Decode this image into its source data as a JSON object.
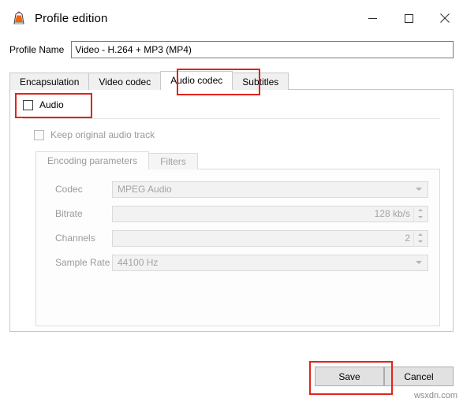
{
  "window": {
    "title": "Profile edition",
    "icon": "vlc-cone-icon",
    "controls": {
      "minimize": "minimize-icon",
      "maximize": "maximize-icon",
      "close": "close-icon"
    }
  },
  "profile": {
    "label": "Profile Name",
    "value": "Video - H.264 + MP3 (MP4)",
    "placeholder": ""
  },
  "tabs": [
    {
      "label": "Encapsulation",
      "active": false
    },
    {
      "label": "Video codec",
      "active": false
    },
    {
      "label": "Audio codec",
      "active": true
    },
    {
      "label": "Subtitles",
      "active": false
    }
  ],
  "audio_panel": {
    "audio_checkbox": {
      "label": "Audio",
      "checked": false
    },
    "keep_original": {
      "label": "Keep original audio track",
      "checked": false,
      "disabled": true
    },
    "inner_tabs": [
      {
        "label": "Encoding parameters",
        "active": true
      },
      {
        "label": "Filters",
        "active": false
      }
    ],
    "fields": [
      {
        "name": "codec",
        "label": "Codec",
        "type": "combo",
        "value": "MPEG Audio"
      },
      {
        "name": "bitrate",
        "label": "Bitrate",
        "type": "spin",
        "value": "128 kb/s"
      },
      {
        "name": "channels",
        "label": "Channels",
        "type": "spin",
        "value": "2"
      },
      {
        "name": "samplerate",
        "label": "Sample Rate",
        "type": "combo",
        "value": "44100 Hz"
      }
    ]
  },
  "buttons": {
    "save": "Save",
    "cancel": "Cancel"
  },
  "watermark": "wsxdn.com",
  "colors": {
    "highlight": "#e2231a",
    "accent": "#ff8c00"
  }
}
